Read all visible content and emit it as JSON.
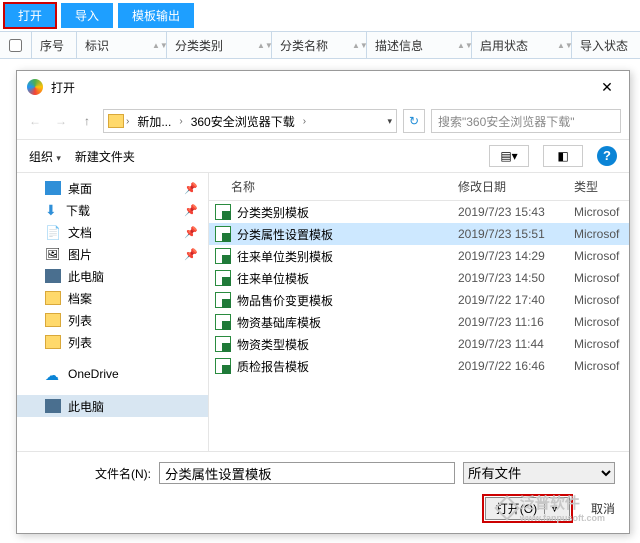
{
  "toolbar": {
    "open": "打开",
    "import": "导入",
    "template": "模板输出"
  },
  "grid": {
    "seq": "序号",
    "flag": "标识",
    "catType": "分类类别",
    "catName": "分类名称",
    "desc": "描述信息",
    "enable": "启用状态",
    "importStatus": "导入状态"
  },
  "dialog": {
    "title": "打开",
    "breadcrumb": {
      "seg1": "新加...",
      "seg2": "360安全浏览器下载"
    },
    "searchPlaceholder": "搜索\"360安全浏览器下载\"",
    "organize": "组织",
    "newFolder": "新建文件夹",
    "nav": {
      "desktop": "桌面",
      "downloads": "下载",
      "documents": "文档",
      "pictures": "图片",
      "thispc": "此电脑",
      "archive": "档案",
      "list": "列表",
      "onedrive": "OneDrive"
    },
    "cols": {
      "name": "名称",
      "date": "修改日期",
      "type": "类型"
    },
    "files": [
      {
        "name": "分类类别模板",
        "date": "2019/7/23 15:43",
        "type": "Microsof"
      },
      {
        "name": "分类属性设置模板",
        "date": "2019/7/23 15:51",
        "type": "Microsof"
      },
      {
        "name": "往来单位类别模板",
        "date": "2019/7/23 14:29",
        "type": "Microsof"
      },
      {
        "name": "往来单位模板",
        "date": "2019/7/23 14:50",
        "type": "Microsof"
      },
      {
        "name": "物品售价变更模板",
        "date": "2019/7/22 17:40",
        "type": "Microsof"
      },
      {
        "name": "物资基础库模板",
        "date": "2019/7/23 11:16",
        "type": "Microsof"
      },
      {
        "name": "物资类型模板",
        "date": "2019/7/23 11:44",
        "type": "Microsof"
      },
      {
        "name": "质检报告模板",
        "date": "2019/7/22 16:46",
        "type": "Microsof"
      }
    ],
    "fileNameLabel": "文件名(N):",
    "fileNameValue": "分类属性设置模板",
    "filter": "所有文件",
    "openBtn": "打开(O)",
    "cancel": "取消"
  },
  "watermark": {
    "brand": "泛普软件",
    "url": "www.fanpusoft.com"
  }
}
